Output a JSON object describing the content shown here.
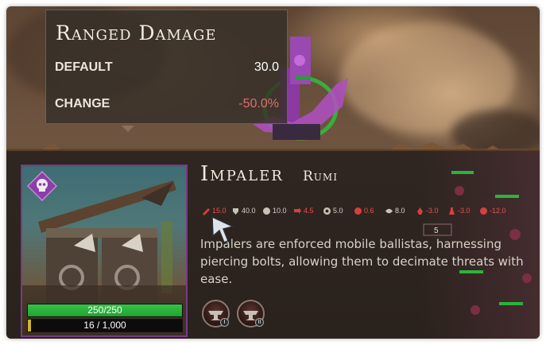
{
  "tooltip": {
    "title": "Ranged Damage",
    "rows": [
      {
        "label": "DEFAULT",
        "value": "30.0",
        "value_color": "#ffffff"
      },
      {
        "label": "CHANGE",
        "value": "-50.0%",
        "value_color": "#e26c6c"
      }
    ]
  },
  "unit": {
    "name": "Impaler",
    "faction": "Rumi",
    "description": "Impalers are enforced mobile ballistas, harnessing piercing bolts, allowing them to decimate threats with ease.",
    "health": {
      "current": 250,
      "max": 250,
      "text": "250/250",
      "fraction": 1.0
    },
    "experience": {
      "current": 16,
      "max": 1000,
      "text": "16 / 1,000",
      "fraction": 0.016
    },
    "faction_badge_icon": "skull-icon"
  },
  "stats": [
    {
      "icon": "ranged-damage-icon",
      "value": "15.0",
      "color": "#e85050"
    },
    {
      "icon": "armor-icon",
      "value": "40.0",
      "color": "#d8d2c6"
    },
    {
      "icon": "clock-icon",
      "value": "10.0",
      "color": "#d8d2c6"
    },
    {
      "icon": "speed-arrows-icon",
      "value": "4.5",
      "color": "#e85050"
    },
    {
      "icon": "range-target-icon",
      "value": "5.0",
      "color": "#d8d2c6"
    },
    {
      "icon": "move-speed-icon",
      "value": "0.6",
      "color": "#e85050"
    },
    {
      "icon": "vision-eye-icon",
      "value": "8.0",
      "color": "#d8d2c6"
    },
    {
      "icon": "food-cost-icon",
      "value": "-3.0",
      "color": "#e85050"
    },
    {
      "icon": "population-icon",
      "value": "-3.0",
      "color": "#e85050"
    },
    {
      "icon": "gold-cost-icon",
      "value": "-12.0",
      "color": "#e85050"
    }
  ],
  "abilities": [
    {
      "icon": "anvil-ability-icon",
      "badge": "I"
    },
    {
      "icon": "anvil-ability-icon",
      "badge": "II"
    }
  ],
  "map": {
    "marker_number": "5"
  },
  "colors": {
    "accent_purple": "#7a3a86",
    "negative": "#e85050",
    "health": "#2bb33d",
    "xp": "#d4b42a"
  }
}
